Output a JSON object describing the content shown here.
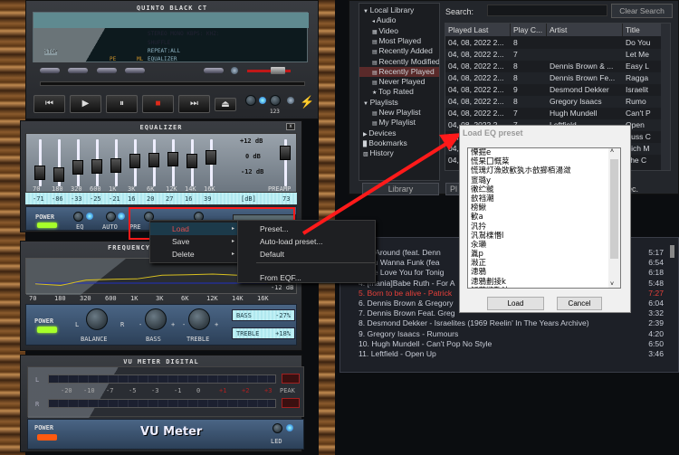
{
  "player": {
    "title": "QUINTO BLACK CT",
    "lcd": {
      "line1": "STEREO MONO  KBPS:      KHZ:",
      "line2": "SHUFFLE",
      "line3": "REPEAT:ALL",
      "status": "STOP",
      "line4": "EQUALIZER",
      "pe": "PE",
      "ml": "ML"
    },
    "transport": {
      "prev": "⏮",
      "play": "▶",
      "pause": "⏸",
      "stop": "■",
      "next": "⏭",
      "eject": "⏏"
    },
    "volume": 0.8,
    "labels": {
      "ab": "123"
    }
  },
  "equalizer": {
    "title": "EQUALIZER",
    "close": "x",
    "bands": [
      "70",
      "180",
      "320",
      "600",
      "1K",
      "3K",
      "6K",
      "12K",
      "14K",
      "16K"
    ],
    "values": [
      -7.1,
      -8.6,
      -3.3,
      -2.5,
      -2.1,
      1.6,
      2.0,
      2.7,
      1.6,
      3.9
    ],
    "display": [
      "-71",
      "-86",
      "-33",
      "-25",
      "-21",
      "16",
      "20",
      "27",
      "16",
      "39"
    ],
    "unit": "[dB]",
    "preamp_label": "PREAMP",
    "preamp_value": 7.3,
    "preamp_display": "73",
    "db_top": "+12 dB",
    "db_mid": "0 dB",
    "db_bot": "-12 dB",
    "power": "POWER",
    "eq": "EQ",
    "auto": "AUTO",
    "presets": "PRE"
  },
  "context_menu": {
    "items": [
      "Load",
      "Save",
      "Delete"
    ],
    "submenu": [
      "Preset...",
      "Auto-load preset...",
      "Default",
      "From EQF..."
    ]
  },
  "frequency": {
    "title": "FREQUENCY",
    "db_label": "-12 dB",
    "bands": [
      "70",
      "180",
      "320",
      "600",
      "1K",
      "3K",
      "6K",
      "12K",
      "14K",
      "16K"
    ],
    "power": "POWER",
    "balance": "BALANCE",
    "bass": "BASS",
    "treble": "TREBLE",
    "l": "L",
    "r": "R",
    "minus": "-",
    "plus": "+",
    "bass_readout": {
      "label": "BASS",
      "value": "-27%"
    },
    "treble_readout": {
      "label": "TREBLE",
      "value": "+18%"
    }
  },
  "vu": {
    "title": "VU METER DIGITAL",
    "l": "L",
    "r": "R",
    "scale": [
      "-20",
      "-10",
      "-7",
      "-5",
      "-3",
      "-1",
      "0",
      "+1",
      "+2",
      "+3"
    ],
    "peak": "PEAK",
    "power": "POWER",
    "logo": "VU Meter",
    "led": "LED"
  },
  "library": {
    "search_label": "Search:",
    "search_value": "",
    "clear_search": "Clear Search",
    "tree": [
      {
        "label": "Local Library",
        "level": 0,
        "icon": "triangle-down"
      },
      {
        "label": "Audio",
        "level": 1,
        "icon": "speaker"
      },
      {
        "label": "Video",
        "level": 1,
        "icon": "film"
      },
      {
        "label": "Most Played",
        "level": 1,
        "icon": "smart-view"
      },
      {
        "label": "Recently Added",
        "level": 1,
        "icon": "smart-view"
      },
      {
        "label": "Recently Modified",
        "level": 1,
        "icon": "smart-view"
      },
      {
        "label": "Recently Played",
        "level": 1,
        "icon": "smart-view",
        "selected": true
      },
      {
        "label": "Never Played",
        "level": 1,
        "icon": "smart-view"
      },
      {
        "label": "Top Rated",
        "level": 1,
        "icon": "star-page"
      },
      {
        "label": "Playlists",
        "level": 0,
        "icon": "triangle-down"
      },
      {
        "label": "New Playlist",
        "level": 1,
        "icon": "playlist"
      },
      {
        "label": "My Playlist",
        "level": 1,
        "icon": "playlist"
      },
      {
        "label": "Devices",
        "level": 0,
        "icon": "triangle-right"
      },
      {
        "label": "Bookmarks",
        "level": 0,
        "icon": "page"
      },
      {
        "label": "History",
        "level": 0,
        "icon": "history"
      }
    ],
    "columns": [
      "Played Last",
      "Play C...",
      "Artist",
      "Title"
    ],
    "rows": [
      [
        "04, 08, 2022 2...",
        "8",
        "",
        "Do You"
      ],
      [
        "04, 08, 2022 2...",
        "7",
        "",
        "Let Me"
      ],
      [
        "04, 08, 2022 2...",
        "8",
        "Dennis Brown & ...",
        "Easy L"
      ],
      [
        "04, 08, 2022 2...",
        "8",
        "Dennis Brown Fe...",
        "Ragga"
      ],
      [
        "04, 08, 2022 2...",
        "9",
        "Desmond Dekker",
        "Israelit"
      ],
      [
        "04, 08, 2022 2...",
        "8",
        "Gregory Isaacs",
        "Rumo"
      ],
      [
        "04, 08, 2022 2...",
        "7",
        "Hugh Mundell",
        "Can't P"
      ],
      [
        "04, 08, 2022 2...",
        "7",
        "Leftfield",
        "Open"
      ],
      [
        "04, 08, 2022 2...",
        "",
        "",
        "Cuss C"
      ],
      [
        "04, 08, 2022 2...",
        "",
        "",
        "Rich M"
      ],
      [
        "04, 08, 2022 2...",
        "",
        "",
        "The C"
      ]
    ],
    "library_button": "Library",
    "play_button": "Pl",
    "status_tail": "ec."
  },
  "playlist": {
    "items": [
      {
        "text": "g All Around (feat. Denn",
        "time": "5:17"
      },
      {
        "text": "o You Wanna Funk (fea",
        "time": "6:54"
      },
      {
        "text": "et Me Love You for Tonig",
        "time": "6:18"
      },
      {
        "text": "4. [mania]Babe Ruth - For A",
        "time": "5:48"
      },
      {
        "text": "5. Born to be alive - Patrick",
        "time": "7:27",
        "current": true
      },
      {
        "text": "6. Dennis Brown & Gregory",
        "time": "6:04"
      },
      {
        "text": "7. Dennis Brown Feat. Greg",
        "time": "3:32"
      },
      {
        "text": "8. Desmond Dekker - Israelites (1969 Reelin' In The Years Archive)",
        "time": "2:39"
      },
      {
        "text": "9. Gregory Isaacs - Rumours",
        "time": "4:20"
      },
      {
        "text": "10. Hugh Mundell - Can't Pop No Style",
        "time": "6:50"
      },
      {
        "text": "11. Leftfield - Open Up",
        "time": "3:46"
      }
    ],
    "current_color": "#e8403a"
  },
  "dialog": {
    "title": "Load EQ preset",
    "presets": [
      "慄掘e",
      "慌杲囗慨棻",
      "慌瑰灯漁敚歓犱ホ敨擳栢湯潋",
      "亶璐y",
      "徹纻虩",
      "敨裆潮",
      "榜鰍",
      "歓a",
      "汎扲",
      "汎鵥楪惽l",
      "汆瓎",
      "湚p",
      "潊正",
      "漶鴉",
      "漶鴉劃掕k",
      "觚萦慾歎汁e"
    ],
    "load": "Load",
    "cancel": "Cancel"
  },
  "colors": {
    "highlight_red": "#ff1a1a",
    "accent_blue": "#3a9cff",
    "power_green": "#a6ff2a",
    "power_orange": "#ff5a10"
  }
}
